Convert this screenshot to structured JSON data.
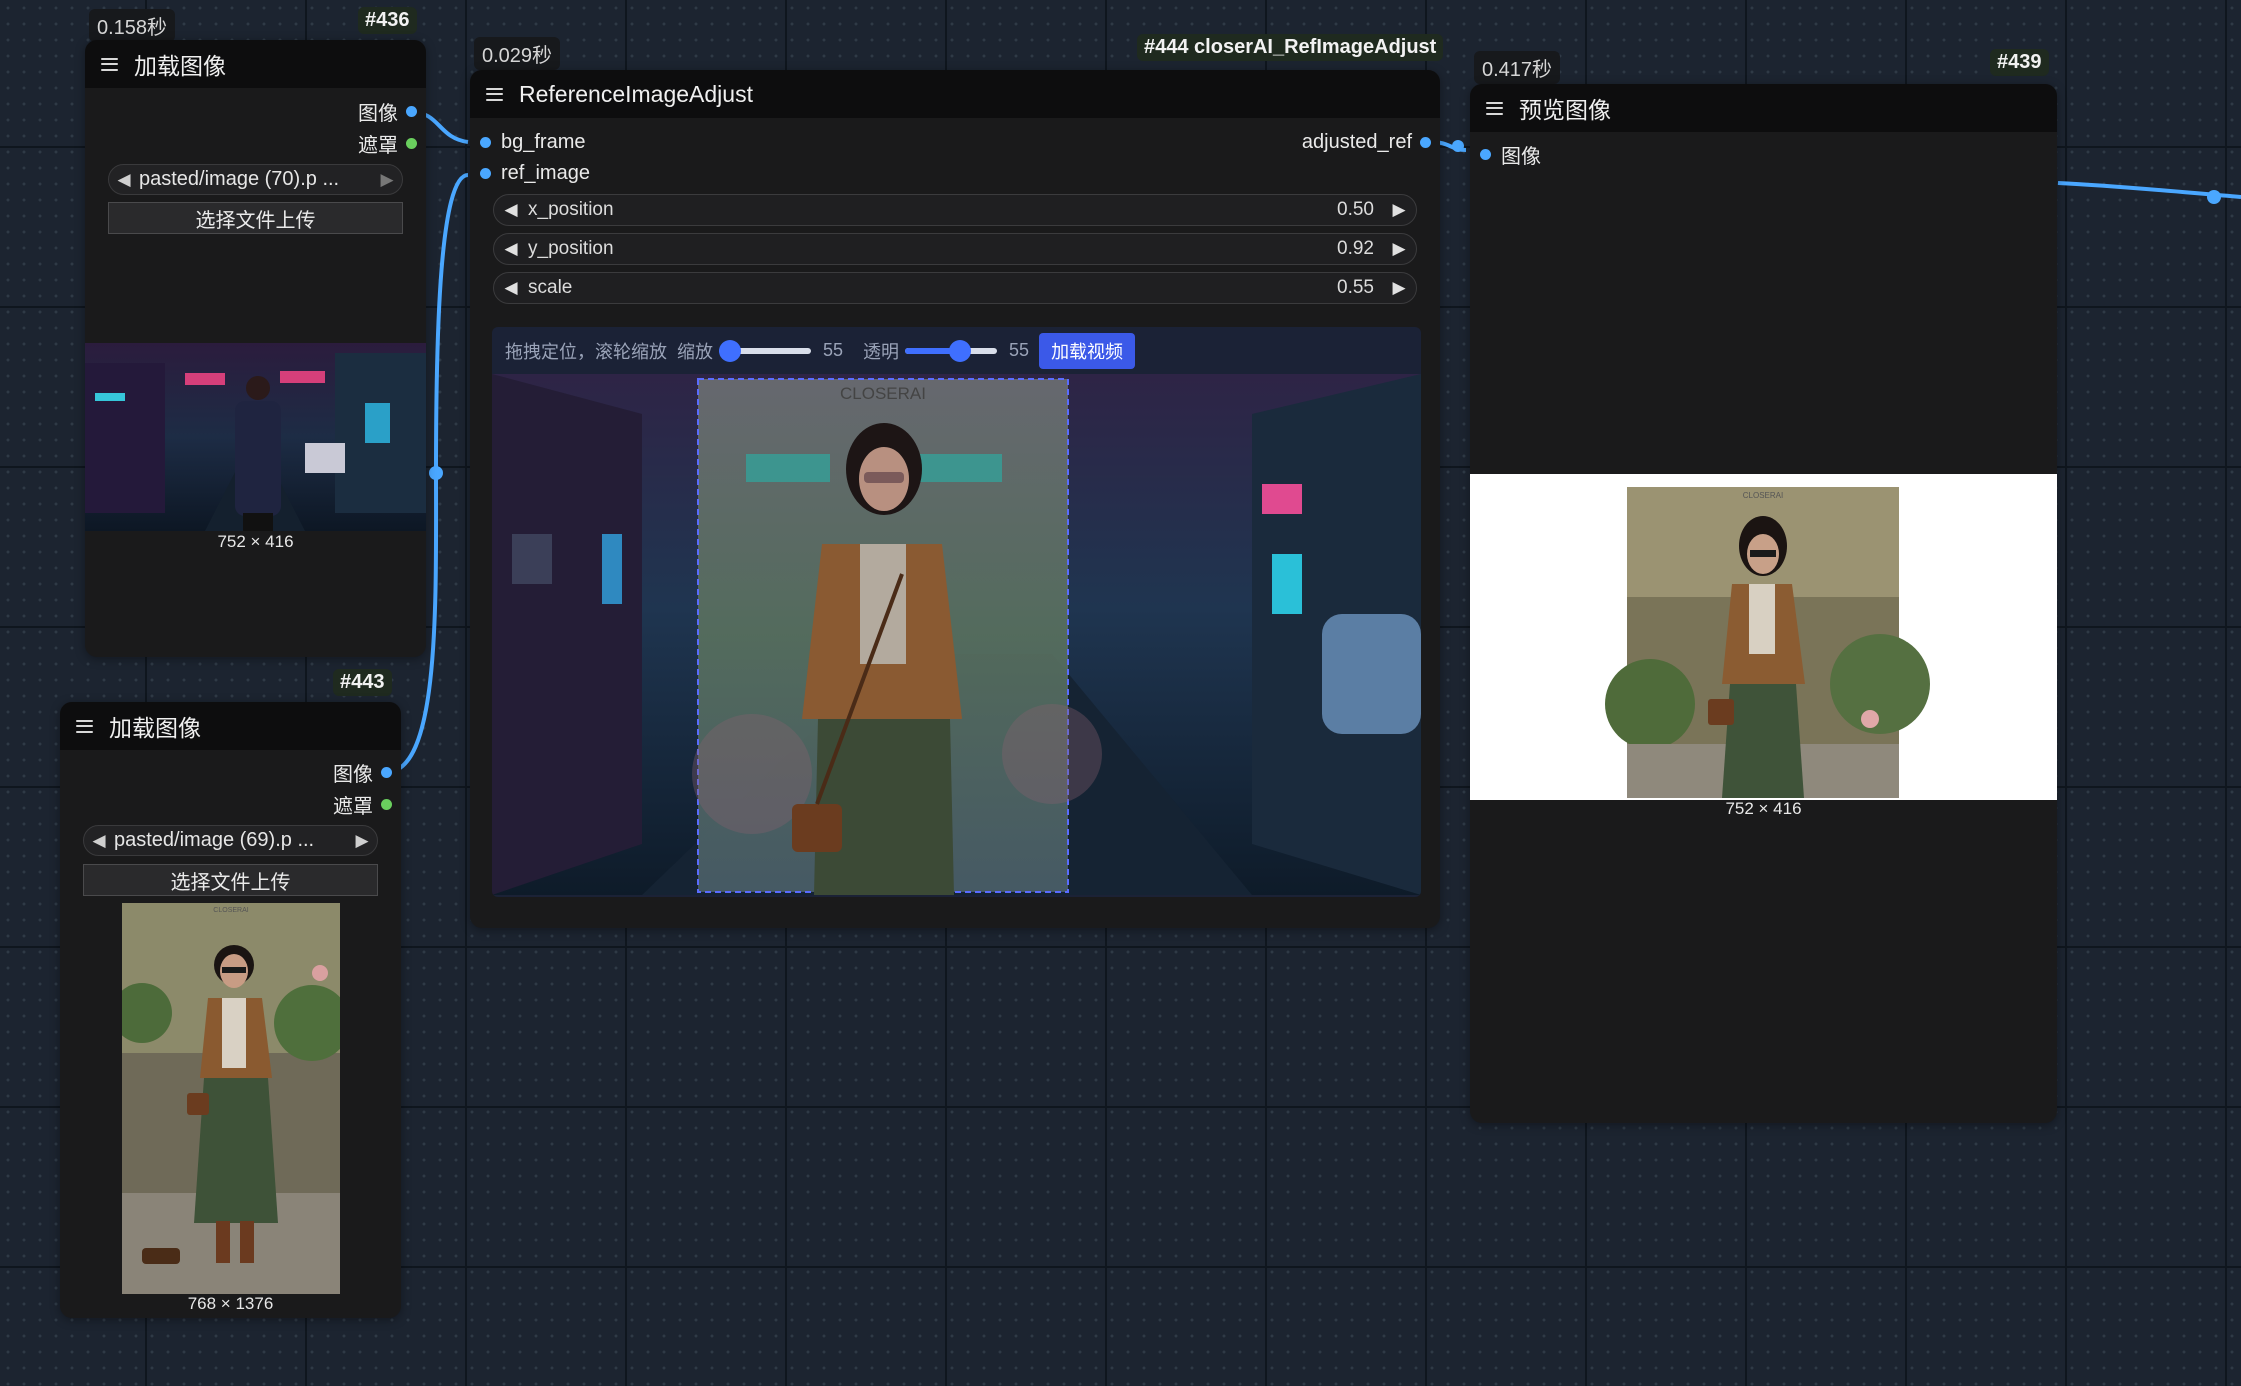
{
  "colors": {
    "accent_blue": "#4aa7ff",
    "mask_green": "#6acf5e",
    "button_blue": "#3b59e8"
  },
  "node436": {
    "time": "0.158秒",
    "id": "#436",
    "title": "加载图像",
    "outputs": [
      "图像",
      "遮罩"
    ],
    "file": "pasted/image (70).p ...",
    "upload": "选择文件上传",
    "dims": "752 × 416"
  },
  "node443": {
    "id": "#443",
    "title": "加载图像",
    "outputs": [
      "图像",
      "遮罩"
    ],
    "file": "pasted/image (69).p ...",
    "upload": "选择文件上传",
    "dims": "768 × 1376"
  },
  "node444": {
    "time": "0.029秒",
    "id": "#444 closerAI_RefImageAdjust",
    "title": "ReferenceImageAdjust",
    "inputs": [
      "bg_frame",
      "ref_image"
    ],
    "output": "adjusted_ref",
    "widgets": [
      {
        "name": "x_position",
        "value": "0.50"
      },
      {
        "name": "y_position",
        "value": "0.92"
      },
      {
        "name": "scale",
        "value": "0.55"
      }
    ],
    "toolbar": {
      "hint": "拖拽定位，滚轮缩放",
      "scale_label": "缩放",
      "scale_value": "55",
      "scale_level": 0.1,
      "opacity_label": "透明",
      "opacity_value": "55",
      "opacity_level": 0.6,
      "load_video": "加载视频"
    },
    "watermark": "CLOSERAI"
  },
  "node439": {
    "time": "0.417秒",
    "id": "#439",
    "title": "预览图像",
    "input": "图像",
    "dims": "752 × 416",
    "watermark": "CLOSERAI"
  }
}
